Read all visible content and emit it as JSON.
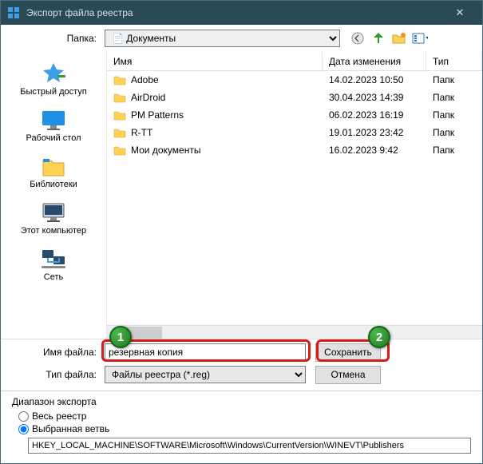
{
  "title": "Экспорт файла реестра",
  "folderbar": {
    "label": "Папка:",
    "selected": "Документы"
  },
  "columns": {
    "name": "Имя",
    "date": "Дата изменения",
    "type": "Тип"
  },
  "sideitems": [
    {
      "label": "Быстрый доступ"
    },
    {
      "label": "Рабочий стол"
    },
    {
      "label": "Библиотеки"
    },
    {
      "label": "Этот компьютер"
    },
    {
      "label": "Сеть"
    }
  ],
  "files": [
    {
      "name": "Adobe",
      "date": "14.02.2023 10:50",
      "type": "Папк"
    },
    {
      "name": "AirDroid",
      "date": "30.04.2023 14:39",
      "type": "Папк"
    },
    {
      "name": "PM Patterns",
      "date": "06.02.2023 16:19",
      "type": "Папк"
    },
    {
      "name": "R-TT",
      "date": "19.01.2023 23:42",
      "type": "Папк"
    },
    {
      "name": "Мои документы",
      "date": "16.02.2023 9:42",
      "type": "Папк"
    }
  ],
  "fields": {
    "filename_label": "Имя файла:",
    "filename_value": "резервная копия",
    "filetype_label": "Тип файла:",
    "filetype_value": "Файлы реестра (*.reg)"
  },
  "buttons": {
    "save": "Сохранить",
    "cancel": "Отмена"
  },
  "export": {
    "group": "Диапазон экспорта",
    "all": "Весь реестр",
    "branch": "Выбранная ветвь",
    "path": "HKEY_LOCAL_MACHINE\\SOFTWARE\\Microsoft\\Windows\\CurrentVersion\\WINEVT\\Publishers"
  },
  "badges": {
    "b1": "1",
    "b2": "2"
  }
}
